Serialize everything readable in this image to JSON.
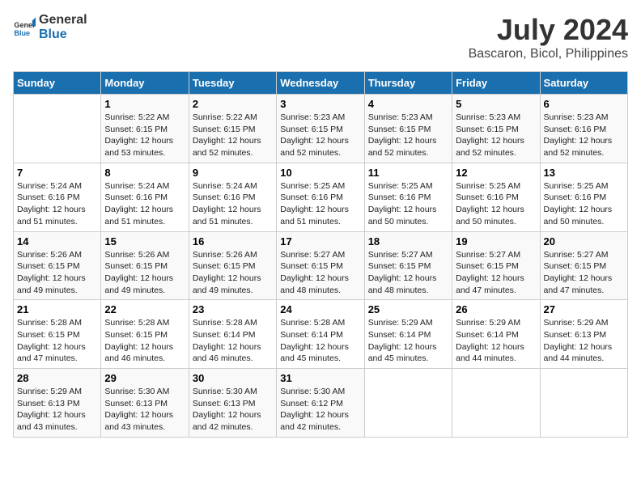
{
  "logo": {
    "text_general": "General",
    "text_blue": "Blue"
  },
  "title": "July 2024",
  "subtitle": "Bascaron, Bicol, Philippines",
  "headers": [
    "Sunday",
    "Monday",
    "Tuesday",
    "Wednesday",
    "Thursday",
    "Friday",
    "Saturday"
  ],
  "weeks": [
    [
      {
        "day": "",
        "info": ""
      },
      {
        "day": "1",
        "info": "Sunrise: 5:22 AM\nSunset: 6:15 PM\nDaylight: 12 hours\nand 53 minutes."
      },
      {
        "day": "2",
        "info": "Sunrise: 5:22 AM\nSunset: 6:15 PM\nDaylight: 12 hours\nand 52 minutes."
      },
      {
        "day": "3",
        "info": "Sunrise: 5:23 AM\nSunset: 6:15 PM\nDaylight: 12 hours\nand 52 minutes."
      },
      {
        "day": "4",
        "info": "Sunrise: 5:23 AM\nSunset: 6:15 PM\nDaylight: 12 hours\nand 52 minutes."
      },
      {
        "day": "5",
        "info": "Sunrise: 5:23 AM\nSunset: 6:15 PM\nDaylight: 12 hours\nand 52 minutes."
      },
      {
        "day": "6",
        "info": "Sunrise: 5:23 AM\nSunset: 6:16 PM\nDaylight: 12 hours\nand 52 minutes."
      }
    ],
    [
      {
        "day": "7",
        "info": "Sunrise: 5:24 AM\nSunset: 6:16 PM\nDaylight: 12 hours\nand 51 minutes."
      },
      {
        "day": "8",
        "info": "Sunrise: 5:24 AM\nSunset: 6:16 PM\nDaylight: 12 hours\nand 51 minutes."
      },
      {
        "day": "9",
        "info": "Sunrise: 5:24 AM\nSunset: 6:16 PM\nDaylight: 12 hours\nand 51 minutes."
      },
      {
        "day": "10",
        "info": "Sunrise: 5:25 AM\nSunset: 6:16 PM\nDaylight: 12 hours\nand 51 minutes."
      },
      {
        "day": "11",
        "info": "Sunrise: 5:25 AM\nSunset: 6:16 PM\nDaylight: 12 hours\nand 50 minutes."
      },
      {
        "day": "12",
        "info": "Sunrise: 5:25 AM\nSunset: 6:16 PM\nDaylight: 12 hours\nand 50 minutes."
      },
      {
        "day": "13",
        "info": "Sunrise: 5:25 AM\nSunset: 6:16 PM\nDaylight: 12 hours\nand 50 minutes."
      }
    ],
    [
      {
        "day": "14",
        "info": "Sunrise: 5:26 AM\nSunset: 6:15 PM\nDaylight: 12 hours\nand 49 minutes."
      },
      {
        "day": "15",
        "info": "Sunrise: 5:26 AM\nSunset: 6:15 PM\nDaylight: 12 hours\nand 49 minutes."
      },
      {
        "day": "16",
        "info": "Sunrise: 5:26 AM\nSunset: 6:15 PM\nDaylight: 12 hours\nand 49 minutes."
      },
      {
        "day": "17",
        "info": "Sunrise: 5:27 AM\nSunset: 6:15 PM\nDaylight: 12 hours\nand 48 minutes."
      },
      {
        "day": "18",
        "info": "Sunrise: 5:27 AM\nSunset: 6:15 PM\nDaylight: 12 hours\nand 48 minutes."
      },
      {
        "day": "19",
        "info": "Sunrise: 5:27 AM\nSunset: 6:15 PM\nDaylight: 12 hours\nand 47 minutes."
      },
      {
        "day": "20",
        "info": "Sunrise: 5:27 AM\nSunset: 6:15 PM\nDaylight: 12 hours\nand 47 minutes."
      }
    ],
    [
      {
        "day": "21",
        "info": "Sunrise: 5:28 AM\nSunset: 6:15 PM\nDaylight: 12 hours\nand 47 minutes."
      },
      {
        "day": "22",
        "info": "Sunrise: 5:28 AM\nSunset: 6:15 PM\nDaylight: 12 hours\nand 46 minutes."
      },
      {
        "day": "23",
        "info": "Sunrise: 5:28 AM\nSunset: 6:14 PM\nDaylight: 12 hours\nand 46 minutes."
      },
      {
        "day": "24",
        "info": "Sunrise: 5:28 AM\nSunset: 6:14 PM\nDaylight: 12 hours\nand 45 minutes."
      },
      {
        "day": "25",
        "info": "Sunrise: 5:29 AM\nSunset: 6:14 PM\nDaylight: 12 hours\nand 45 minutes."
      },
      {
        "day": "26",
        "info": "Sunrise: 5:29 AM\nSunset: 6:14 PM\nDaylight: 12 hours\nand 44 minutes."
      },
      {
        "day": "27",
        "info": "Sunrise: 5:29 AM\nSunset: 6:13 PM\nDaylight: 12 hours\nand 44 minutes."
      }
    ],
    [
      {
        "day": "28",
        "info": "Sunrise: 5:29 AM\nSunset: 6:13 PM\nDaylight: 12 hours\nand 43 minutes."
      },
      {
        "day": "29",
        "info": "Sunrise: 5:30 AM\nSunset: 6:13 PM\nDaylight: 12 hours\nand 43 minutes."
      },
      {
        "day": "30",
        "info": "Sunrise: 5:30 AM\nSunset: 6:13 PM\nDaylight: 12 hours\nand 42 minutes."
      },
      {
        "day": "31",
        "info": "Sunrise: 5:30 AM\nSunset: 6:12 PM\nDaylight: 12 hours\nand 42 minutes."
      },
      {
        "day": "",
        "info": ""
      },
      {
        "day": "",
        "info": ""
      },
      {
        "day": "",
        "info": ""
      }
    ]
  ]
}
